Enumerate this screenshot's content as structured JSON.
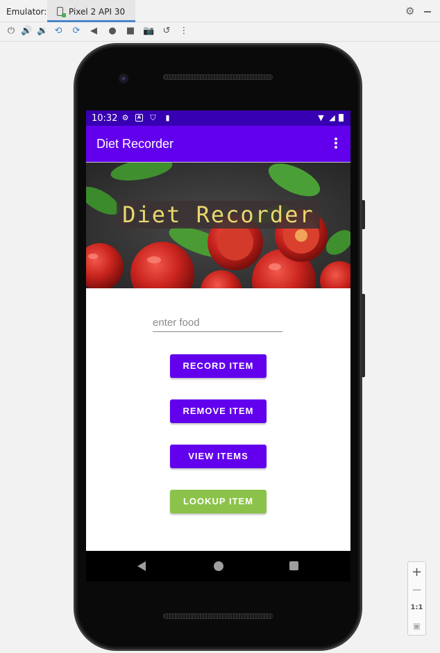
{
  "emulator": {
    "title": "Emulator:",
    "device_tab": "Pixel 2 API 30",
    "toolbar_icons": [
      "power-icon",
      "volume-up-icon",
      "volume-down-icon",
      "rotate-left-icon",
      "rotate-right-icon",
      "back-icon",
      "home-icon",
      "overview-icon",
      "screenshot-icon",
      "snapshot-icon",
      "more-icon"
    ]
  },
  "status_bar": {
    "time": "10:32"
  },
  "app_bar": {
    "title": "Diet Recorder"
  },
  "banner": {
    "text": "Diet Recorder"
  },
  "food_input": {
    "placeholder": "enter food",
    "value": ""
  },
  "buttons": {
    "record": "RECORD ITEM",
    "remove": "REMOVE ITEM",
    "view": "VIEW ITEMS",
    "lookup": "LOOKUP ITEM"
  },
  "zoom_controls": {
    "plus": "+",
    "minus": "−",
    "one_to_one": "1:1"
  },
  "colors": {
    "status_bar": "#3700b3",
    "primary": "#6200ee",
    "lookup_button": "#8bc34a",
    "banner_text": "#e9d76f"
  }
}
